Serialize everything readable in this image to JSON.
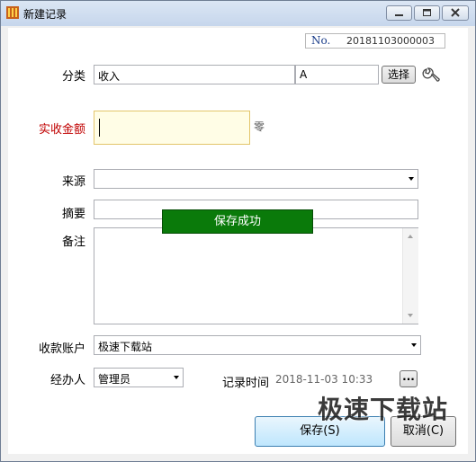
{
  "window": {
    "title": "新建记录"
  },
  "record_no": {
    "prefix": "No.",
    "value": "20181103000003"
  },
  "category": {
    "label": "分类",
    "value": "收入",
    "code": "A",
    "select_label": "选择"
  },
  "amount": {
    "label": "实收金额",
    "value": "",
    "chinese_amount": "零"
  },
  "source": {
    "label": "来源",
    "value": ""
  },
  "summary": {
    "label": "摘要",
    "value": ""
  },
  "remark": {
    "label": "备注",
    "value": ""
  },
  "toast": {
    "text": "保存成功"
  },
  "account": {
    "label": "收款账户",
    "value": "极速下载站"
  },
  "handler": {
    "label": "经办人",
    "value": "管理员"
  },
  "record_time": {
    "label": "记录时间",
    "value": "2018-11-03 10:33",
    "picker_label": "..."
  },
  "buttons": {
    "save": "保存(S)",
    "cancel": "取消(C)"
  },
  "watermark": {
    "text": "极速下载站"
  },
  "colors": {
    "required_label": "#c00000",
    "toast_bg": "#0a7a0a",
    "amount_bg": "#fffde6"
  }
}
